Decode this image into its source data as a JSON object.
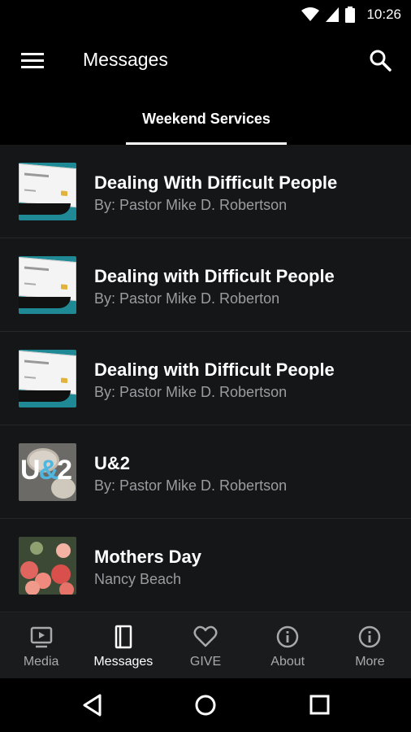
{
  "status": {
    "time": "10:26"
  },
  "header": {
    "title": "Messages"
  },
  "tabs": [
    {
      "label": "Weekend Services",
      "active": true
    }
  ],
  "messages": [
    {
      "title": "Dealing With Difficult People",
      "speaker": "By: Pastor Mike D. Robertson",
      "thumb": "card"
    },
    {
      "title": "Dealing with Difficult People",
      "speaker": "By: Pastor Mike D. Roberton",
      "thumb": "card"
    },
    {
      "title": "Dealing with Difficult People",
      "speaker": "By: Pastor Mike D. Robertson",
      "thumb": "card"
    },
    {
      "title": "U&2",
      "speaker": "By: Pastor Mike D. Robertson",
      "thumb": "u2",
      "thumb_text_left": "U",
      "thumb_text_amp": "&",
      "thumb_text_right": "2"
    },
    {
      "title": "Mothers Day",
      "speaker": "Nancy Beach",
      "thumb": "flowers"
    }
  ],
  "bottom_nav": [
    {
      "label": "Media",
      "icon": "video-icon",
      "active": false
    },
    {
      "label": "Messages",
      "icon": "book-icon",
      "active": true
    },
    {
      "label": "GIVE",
      "icon": "heart-icon",
      "active": false
    },
    {
      "label": "About",
      "icon": "info-icon",
      "active": false
    },
    {
      "label": "More",
      "icon": "info-icon",
      "active": false
    }
  ],
  "colors": {
    "background": "#151618",
    "divider": "#25272a",
    "subtitle": "#9a9ca0",
    "nav_bg": "#1a1b1d",
    "nav_inactive": "#a7a9ac",
    "accent_teal": "#1f8a96"
  }
}
